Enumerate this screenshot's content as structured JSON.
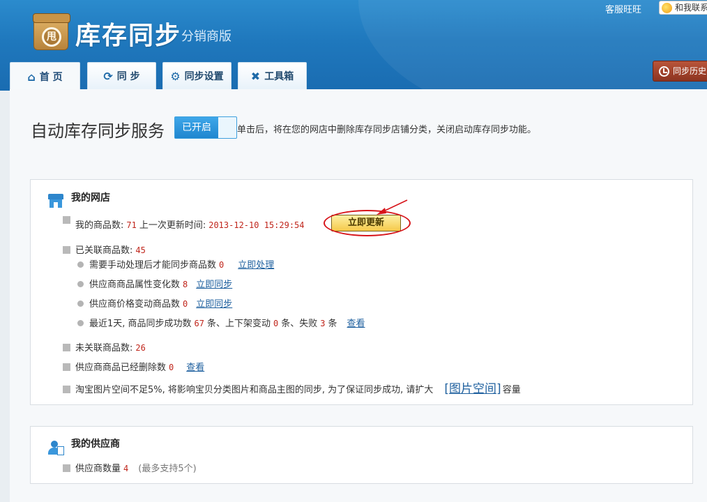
{
  "header": {
    "logo_glyph": "甩",
    "brand_title": "库存同步",
    "brand_subtitle": "分销商版",
    "top_link": "客服旺旺",
    "contact_label": "和我联系",
    "history_label": "同步历史",
    "tabs": [
      {
        "label": "首 页",
        "icon": "home-icon",
        "glyph": "⌂"
      },
      {
        "label": "同 步",
        "icon": "sync-icon",
        "glyph": "⟳"
      },
      {
        "label": "同步设置",
        "icon": "gear-icon",
        "glyph": "⚙"
      },
      {
        "label": "工具箱",
        "icon": "tools-icon",
        "glyph": "✖"
      }
    ]
  },
  "service": {
    "title": "自动库存同步服务",
    "toggle_label": "已开启",
    "description": "单击后，将在您的网店中删除库存同步店铺分类，关闭启动库存同步功能。"
  },
  "my_shop": {
    "title": "我的网店",
    "goods_count_label": "我的商品数:",
    "goods_count": "71",
    "last_update_label": "上一次更新时间:",
    "last_update": "2013-12-10 15:29:54",
    "update_button": "立即更新",
    "linked_label": "已关联商品数:",
    "linked_count": "45",
    "manual_label": "需要手动处理后才能同步商品数",
    "manual_count": "0",
    "manual_link": "立即处理",
    "attr_label": "供应商商品属性变化数",
    "attr_count": "8",
    "attr_link": "立即同步",
    "price_label": "供应商价格变动商品数",
    "price_count": "0",
    "price_link": "立即同步",
    "recent_prefix": "最近1天, 商品同步成功数",
    "recent_success": "67",
    "recent_mid1": "条、上下架变动",
    "recent_shelf": "0",
    "recent_mid2": "条、失败",
    "recent_fail": "3",
    "recent_suffix": "条",
    "recent_link": "查看",
    "unlinked_label": "未关联商品数:",
    "unlinked_count": "26",
    "deleted_label": "供应商商品已经删除数",
    "deleted_count": "0",
    "deleted_link": "查看",
    "space_text": "淘宝图片空间不足5%, 将影响宝贝分类图片和商品主图的同步, 为了保证同步成功, 请扩大",
    "space_link": "[图片空间]",
    "space_suffix": "容量"
  },
  "my_supplier": {
    "title": "我的供应商",
    "count_label": "供应商数量",
    "count": "4",
    "count_note": "(最多支持5个)"
  }
}
